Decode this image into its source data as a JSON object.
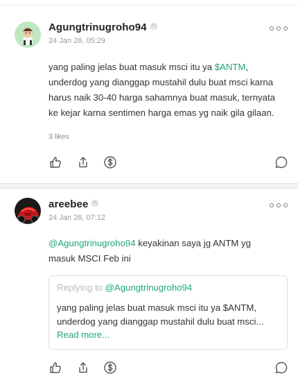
{
  "posts": [
    {
      "username": "Agungtrinugroho94",
      "timestamp": "24 Jan 26, 05:29",
      "text_before": "yang paling jelas buat masuk msci itu ya ",
      "cashtag": "$ANTM",
      "text_after": ", underdog yang dianggap mustahil dulu buat msci karna harus naik 30-40 harga sahamnya buat masuk, ternyata ke kejar karna sentimen harga emas yg naik gila gilaan.",
      "likes": "3 likes"
    },
    {
      "username": "areebee",
      "timestamp": "24 Jan 26, 07:12",
      "mention": "@Agungtrinugroho94",
      "text": " keyakinan saya jg ANTM yg masuk MSCI Feb ini",
      "quote": {
        "replying_prefix": "Replying to ",
        "replying_to": "@Agungtrinugroho94",
        "text": "yang paling jelas buat masuk msci itu ya $ANTM, underdog yang dianggap mustahil dulu buat msci...",
        "read_more": "Read more..."
      }
    }
  ],
  "icons": [
    "thumbs-up-icon",
    "share-icon",
    "dollar-tip-icon",
    "comment-icon",
    "more-options-icon",
    "verified-icon"
  ],
  "colors": {
    "accent": "#1fa67a",
    "text": "#333333",
    "muted": "#999999",
    "border": "#dedede"
  }
}
